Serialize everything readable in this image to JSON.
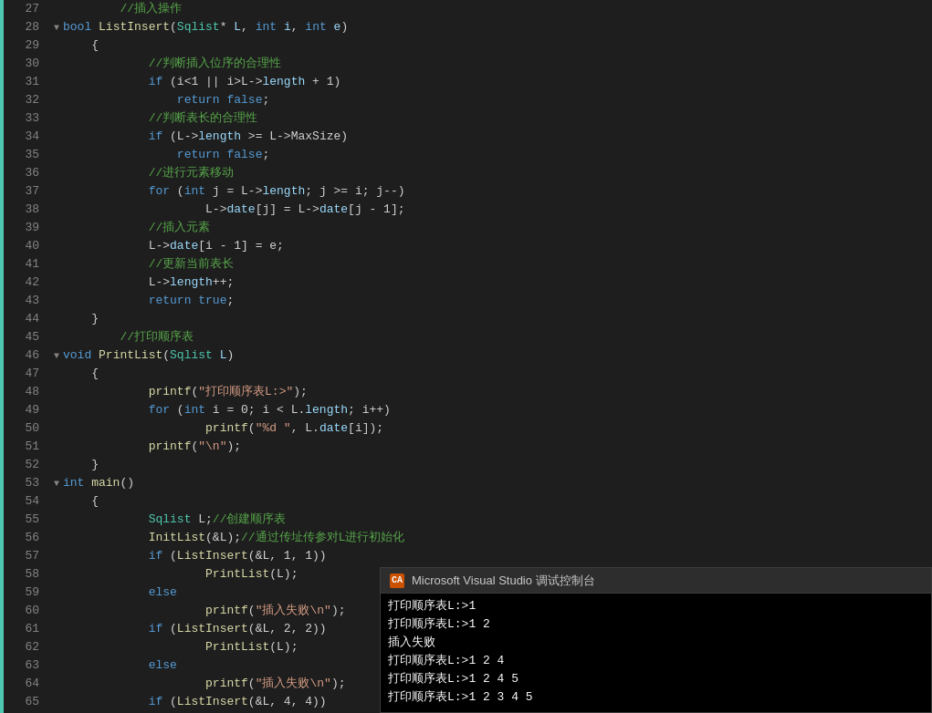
{
  "editor": {
    "lines": [
      {
        "num": "27",
        "indent": 2,
        "collapse": false,
        "content": [
          {
            "t": "comment",
            "v": "//插入操作"
          }
        ]
      },
      {
        "num": "28",
        "indent": 0,
        "collapse": true,
        "content": [
          {
            "t": "kw",
            "v": "bool"
          },
          {
            "t": "norm",
            "v": " "
          },
          {
            "t": "fn",
            "v": "ListInsert"
          },
          {
            "t": "norm",
            "v": "("
          },
          {
            "t": "type",
            "v": "Sqlist"
          },
          {
            "t": "norm",
            "v": "* "
          },
          {
            "t": "param",
            "v": "L"
          },
          {
            "t": "norm",
            "v": ", "
          },
          {
            "t": "kw",
            "v": "int"
          },
          {
            "t": "norm",
            "v": " "
          },
          {
            "t": "param",
            "v": "i"
          },
          {
            "t": "norm",
            "v": ", "
          },
          {
            "t": "kw",
            "v": "int"
          },
          {
            "t": "norm",
            "v": " "
          },
          {
            "t": "param",
            "v": "e"
          },
          {
            "t": "norm",
            "v": ")"
          }
        ]
      },
      {
        "num": "29",
        "indent": 1,
        "collapse": false,
        "content": [
          {
            "t": "norm",
            "v": "{"
          }
        ]
      },
      {
        "num": "30",
        "indent": 3,
        "collapse": false,
        "content": [
          {
            "t": "comment",
            "v": "//判断插入位序的合理性"
          }
        ]
      },
      {
        "num": "31",
        "indent": 3,
        "collapse": false,
        "content": [
          {
            "t": "kw",
            "v": "if"
          },
          {
            "t": "norm",
            "v": " (i<1 || i>L->"
          },
          {
            "t": "param",
            "v": "length"
          },
          {
            "t": "norm",
            "v": " + 1)"
          }
        ]
      },
      {
        "num": "32",
        "indent": 4,
        "collapse": false,
        "content": [
          {
            "t": "kw",
            "v": "return"
          },
          {
            "t": "norm",
            "v": " "
          },
          {
            "t": "kw",
            "v": "false"
          },
          {
            "t": "norm",
            "v": ";"
          }
        ]
      },
      {
        "num": "33",
        "indent": 3,
        "collapse": false,
        "content": [
          {
            "t": "comment",
            "v": "//判断表长的合理性"
          }
        ]
      },
      {
        "num": "34",
        "indent": 3,
        "collapse": false,
        "content": [
          {
            "t": "kw",
            "v": "if"
          },
          {
            "t": "norm",
            "v": " (L->"
          },
          {
            "t": "param",
            "v": "length"
          },
          {
            "t": "norm",
            "v": " >= L->MaxSize)"
          }
        ]
      },
      {
        "num": "35",
        "indent": 4,
        "collapse": false,
        "content": [
          {
            "t": "kw",
            "v": "return"
          },
          {
            "t": "norm",
            "v": " "
          },
          {
            "t": "kw",
            "v": "false"
          },
          {
            "t": "norm",
            "v": ";"
          }
        ]
      },
      {
        "num": "36",
        "indent": 3,
        "collapse": false,
        "content": [
          {
            "t": "comment",
            "v": "//进行元素移动"
          }
        ]
      },
      {
        "num": "37",
        "indent": 3,
        "collapse": false,
        "content": [
          {
            "t": "kw",
            "v": "for"
          },
          {
            "t": "norm",
            "v": " ("
          },
          {
            "t": "kw",
            "v": "int"
          },
          {
            "t": "norm",
            "v": " j = L->"
          },
          {
            "t": "param",
            "v": "length"
          },
          {
            "t": "norm",
            "v": "; j >= i; j--)"
          }
        ]
      },
      {
        "num": "38",
        "indent": 5,
        "collapse": false,
        "content": [
          {
            "t": "norm",
            "v": "L->"
          },
          {
            "t": "param",
            "v": "date"
          },
          {
            "t": "norm",
            "v": "[j] = L->"
          },
          {
            "t": "param",
            "v": "date"
          },
          {
            "t": "norm",
            "v": "[j - 1];"
          }
        ]
      },
      {
        "num": "39",
        "indent": 3,
        "collapse": false,
        "content": [
          {
            "t": "comment",
            "v": "//插入元素"
          }
        ]
      },
      {
        "num": "40",
        "indent": 3,
        "collapse": false,
        "content": [
          {
            "t": "norm",
            "v": "L->"
          },
          {
            "t": "param",
            "v": "date"
          },
          {
            "t": "norm",
            "v": "[i - 1] = e;"
          }
        ]
      },
      {
        "num": "41",
        "indent": 3,
        "collapse": false,
        "content": [
          {
            "t": "comment",
            "v": "//更新当前表长"
          }
        ]
      },
      {
        "num": "42",
        "indent": 3,
        "collapse": false,
        "content": [
          {
            "t": "norm",
            "v": "L->"
          },
          {
            "t": "param",
            "v": "length"
          },
          {
            "t": "norm",
            "v": "++;"
          }
        ]
      },
      {
        "num": "43",
        "indent": 3,
        "collapse": false,
        "content": [
          {
            "t": "kw",
            "v": "return"
          },
          {
            "t": "norm",
            "v": " "
          },
          {
            "t": "kw",
            "v": "true"
          },
          {
            "t": "norm",
            "v": ";"
          }
        ]
      },
      {
        "num": "44",
        "indent": 1,
        "collapse": false,
        "content": [
          {
            "t": "norm",
            "v": "}"
          }
        ]
      },
      {
        "num": "45",
        "indent": 2,
        "collapse": false,
        "content": [
          {
            "t": "comment",
            "v": "//打印顺序表"
          }
        ]
      },
      {
        "num": "46",
        "indent": 0,
        "collapse": true,
        "content": [
          {
            "t": "kw",
            "v": "void"
          },
          {
            "t": "norm",
            "v": " "
          },
          {
            "t": "fn",
            "v": "PrintList"
          },
          {
            "t": "norm",
            "v": "("
          },
          {
            "t": "type",
            "v": "Sqlist"
          },
          {
            "t": "norm",
            "v": " "
          },
          {
            "t": "param",
            "v": "L"
          },
          {
            "t": "norm",
            "v": ")"
          }
        ]
      },
      {
        "num": "47",
        "indent": 1,
        "collapse": false,
        "content": [
          {
            "t": "norm",
            "v": "{"
          }
        ]
      },
      {
        "num": "48",
        "indent": 3,
        "collapse": false,
        "content": [
          {
            "t": "fn",
            "v": "printf"
          },
          {
            "t": "norm",
            "v": "("
          },
          {
            "t": "string",
            "v": "\"打印顺序表L:>\""
          },
          {
            "t": "norm",
            "v": ");"
          }
        ]
      },
      {
        "num": "49",
        "indent": 3,
        "collapse": false,
        "content": [
          {
            "t": "kw",
            "v": "for"
          },
          {
            "t": "norm",
            "v": " ("
          },
          {
            "t": "kw",
            "v": "int"
          },
          {
            "t": "norm",
            "v": " i = 0; i < L."
          },
          {
            "t": "param",
            "v": "length"
          },
          {
            "t": "norm",
            "v": "; i++)"
          }
        ]
      },
      {
        "num": "50",
        "indent": 5,
        "collapse": false,
        "content": [
          {
            "t": "fn",
            "v": "printf"
          },
          {
            "t": "norm",
            "v": "("
          },
          {
            "t": "string",
            "v": "\"%d \""
          },
          {
            "t": "norm",
            "v": ", L."
          },
          {
            "t": "param",
            "v": "date"
          },
          {
            "t": "norm",
            "v": "[i]);"
          }
        ]
      },
      {
        "num": "51",
        "indent": 3,
        "collapse": false,
        "content": [
          {
            "t": "fn",
            "v": "printf"
          },
          {
            "t": "norm",
            "v": "("
          },
          {
            "t": "string",
            "v": "\"\\n\""
          },
          {
            "t": "norm",
            "v": ");"
          }
        ]
      },
      {
        "num": "52",
        "indent": 1,
        "collapse": false,
        "content": [
          {
            "t": "norm",
            "v": "}"
          }
        ]
      },
      {
        "num": "53",
        "indent": 0,
        "collapse": true,
        "content": [
          {
            "t": "kw",
            "v": "int"
          },
          {
            "t": "norm",
            "v": " "
          },
          {
            "t": "fn",
            "v": "main"
          },
          {
            "t": "norm",
            "v": "()"
          }
        ]
      },
      {
        "num": "54",
        "indent": 1,
        "collapse": false,
        "content": [
          {
            "t": "norm",
            "v": "{"
          }
        ]
      },
      {
        "num": "55",
        "indent": 3,
        "collapse": false,
        "content": [
          {
            "t": "type",
            "v": "Sqlist"
          },
          {
            "t": "norm",
            "v": " L;"
          },
          {
            "t": "comment",
            "v": "//创建顺序表"
          }
        ]
      },
      {
        "num": "56",
        "indent": 3,
        "collapse": false,
        "content": [
          {
            "t": "fn",
            "v": "InitList"
          },
          {
            "t": "norm",
            "v": "(&L);"
          },
          {
            "t": "comment",
            "v": "//通过传址传参对L进行初始化"
          }
        ]
      },
      {
        "num": "57",
        "indent": 3,
        "collapse": false,
        "content": [
          {
            "t": "kw",
            "v": "if"
          },
          {
            "t": "norm",
            "v": " ("
          },
          {
            "t": "fn",
            "v": "ListInsert"
          },
          {
            "t": "norm",
            "v": "(&L, 1, 1))"
          }
        ]
      },
      {
        "num": "58",
        "indent": 5,
        "collapse": false,
        "content": [
          {
            "t": "fn",
            "v": "PrintList"
          },
          {
            "t": "norm",
            "v": "(L);"
          }
        ]
      },
      {
        "num": "59",
        "indent": 3,
        "collapse": false,
        "content": [
          {
            "t": "kw",
            "v": "else"
          }
        ]
      },
      {
        "num": "60",
        "indent": 5,
        "collapse": false,
        "content": [
          {
            "t": "fn",
            "v": "printf"
          },
          {
            "t": "norm",
            "v": "("
          },
          {
            "t": "string",
            "v": "\"插入失败\\n\""
          },
          {
            "t": "norm",
            "v": ");"
          }
        ]
      },
      {
        "num": "61",
        "indent": 3,
        "collapse": false,
        "content": [
          {
            "t": "kw",
            "v": "if"
          },
          {
            "t": "norm",
            "v": " ("
          },
          {
            "t": "fn",
            "v": "ListInsert"
          },
          {
            "t": "norm",
            "v": "(&L, 2, 2))"
          }
        ]
      },
      {
        "num": "62",
        "indent": 5,
        "collapse": false,
        "content": [
          {
            "t": "fn",
            "v": "PrintList"
          },
          {
            "t": "norm",
            "v": "(L);"
          }
        ]
      },
      {
        "num": "63",
        "indent": 3,
        "collapse": false,
        "content": [
          {
            "t": "kw",
            "v": "else"
          }
        ]
      },
      {
        "num": "64",
        "indent": 5,
        "collapse": false,
        "content": [
          {
            "t": "fn",
            "v": "printf"
          },
          {
            "t": "norm",
            "v": "("
          },
          {
            "t": "string",
            "v": "\"插入失败\\n\""
          },
          {
            "t": "norm",
            "v": ");"
          }
        ]
      },
      {
        "num": "65",
        "indent": 3,
        "collapse": false,
        "content": [
          {
            "t": "kw",
            "v": "if"
          },
          {
            "t": "norm",
            "v": " ("
          },
          {
            "t": "fn",
            "v": "ListInsert"
          },
          {
            "t": "norm",
            "v": "(&L, 4, 4))"
          }
        ]
      }
    ]
  },
  "console": {
    "title": "Microsoft Visual Studio 调试控制台",
    "icon_text": "CA",
    "output_lines": [
      "打印顺序表L:>1",
      "打印顺序表L:>1 2",
      "插入失败",
      "打印顺序表L:>1 2 4",
      "打印顺序表L:>1 2 4 5",
      "打印顺序表L:>1 2 3 4 5"
    ]
  }
}
